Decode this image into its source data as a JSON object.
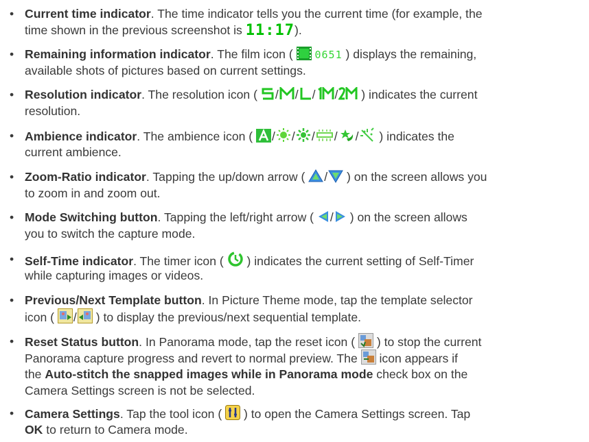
{
  "bullet_char": "•",
  "accent_green": "#22c622",
  "items": [
    {
      "title": "Current time indicator",
      "lines": [
        ". The time indicator tells you the current time (for example, the",
        "time shown in the previous screenshot is ",
        ")."
      ],
      "time_value": "11:17"
    },
    {
      "title": "Remaining information indicator",
      "lines": [
        ". The film icon ( ",
        " ) displays the remaining,",
        "available shots of pictures based on current settings."
      ],
      "counter_value": "0651",
      "icon": "film-icon"
    },
    {
      "title": "Resolution indicator",
      "lines": [
        ". The resolution icon ( ",
        " ) indicates the current",
        "resolution."
      ],
      "icons": [
        "resolution-s-icon",
        "resolution-m-icon",
        "resolution-l-icon",
        "resolution-1m-icon",
        "resolution-2m-icon"
      ],
      "icon_labels": [
        "S",
        "M",
        "L",
        "1M",
        "2M"
      ]
    },
    {
      "title": "Ambience indicator",
      "lines": [
        ". The ambience icon ( ",
        " ) indicates the",
        "current ambience."
      ],
      "icons": [
        "ambience-auto-icon",
        "ambience-sunny-icon",
        "ambience-bright-icon",
        "ambience-fluorescent-icon",
        "ambience-night-icon",
        "ambience-sparkle-icon"
      ]
    },
    {
      "title": "Zoom-Ratio indicator",
      "lines": [
        ". Tapping the up/down arrow ( ",
        " ) on the screen allows you",
        "to zoom in and zoom out."
      ],
      "icons": [
        "zoom-up-arrow-icon",
        "zoom-down-arrow-icon"
      ]
    },
    {
      "title": "Mode Switching button",
      "lines": [
        ". Tapping the left/right arrow ( ",
        " ) on the screen allows",
        "you to switch the capture mode."
      ],
      "icons": [
        "left-arrow-icon",
        "right-arrow-icon"
      ]
    },
    {
      "title": "Self-Time indicator",
      "lines": [
        ". The timer icon ( ",
        " ) indicates the current setting of Self-Timer",
        "while capturing images or videos."
      ],
      "icons": [
        "self-timer-icon"
      ]
    },
    {
      "title": "Previous/Next Template button",
      "lines": [
        ". In Picture Theme mode, tap the template selector",
        "icon ( ",
        " ) to display the previous/next sequential template."
      ],
      "icons": [
        "template-previous-icon",
        "template-next-icon"
      ]
    },
    {
      "title": "Reset Status button",
      "lines": [
        ". In Panorama mode, tap the reset icon ( ",
        " ) to stop the current",
        "Panorama capture progress and revert to normal preview. The ",
        " icon appears if",
        "the ",
        " check box on the",
        "Camera Settings screen is not be selected."
      ],
      "bold_phrase": "Auto-stitch the snapped images while in Panorama mode",
      "icons": [
        "panorama-reset-icon",
        "panorama-stitch-icon"
      ]
    },
    {
      "title": "Camera Settings",
      "lines": [
        ". Tap the tool icon ( ",
        " ) to open the Camera Settings screen. Tap",
        " to return to Camera mode."
      ],
      "bold_word": "OK",
      "icons": [
        "tool-settings-icon"
      ]
    }
  ]
}
